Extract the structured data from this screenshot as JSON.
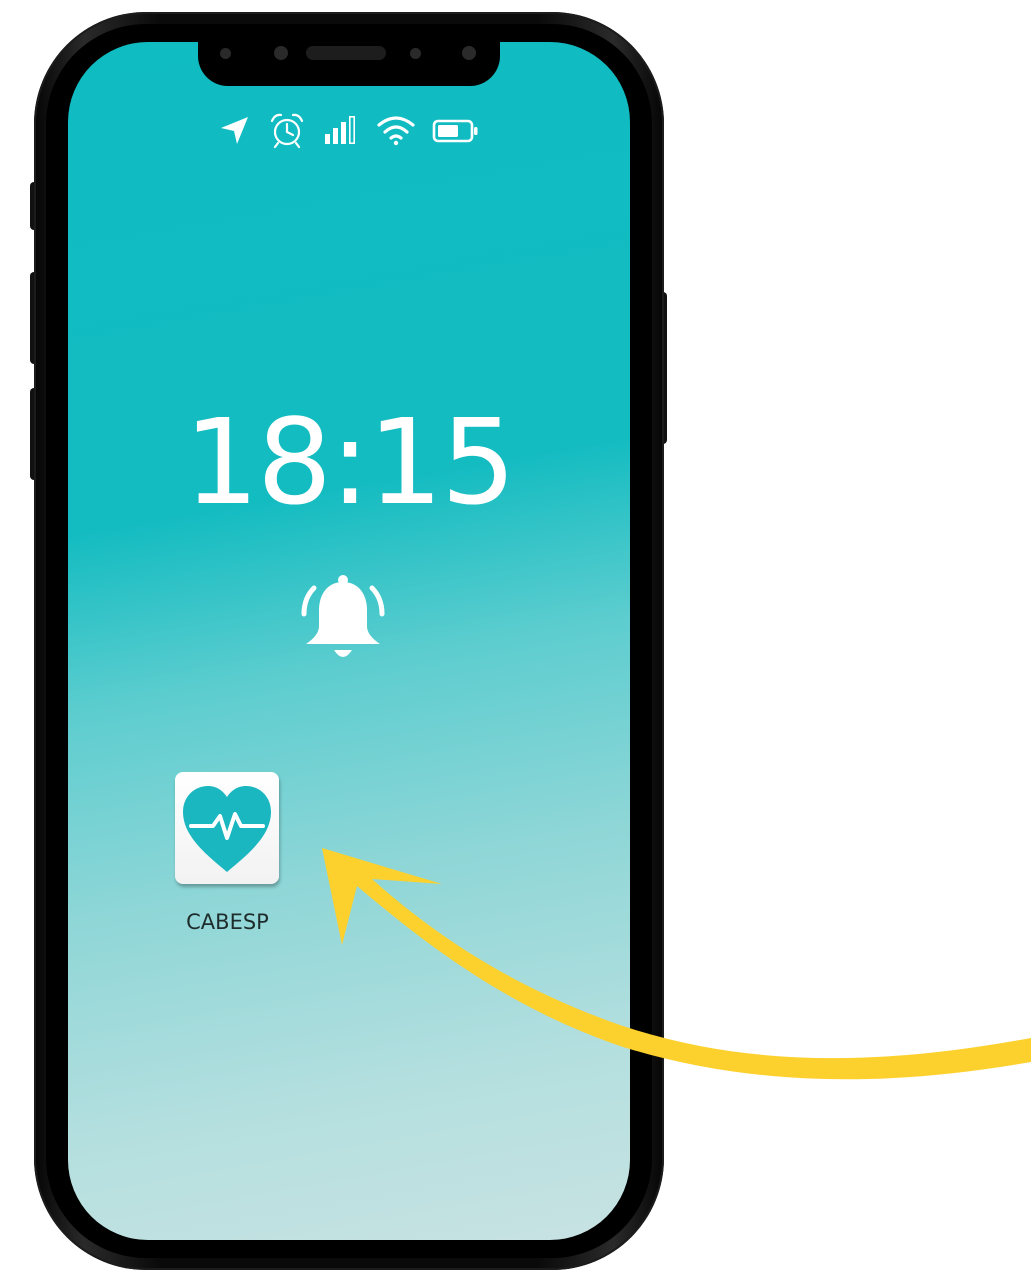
{
  "lock_screen": {
    "time": "18:15",
    "alarm_icon": "alarm-bell-icon"
  },
  "status_bar": {
    "icons": [
      "location-arrow-icon",
      "alarm-clock-icon",
      "cellular-signal-icon",
      "wifi-icon",
      "battery-icon"
    ]
  },
  "home_apps": [
    {
      "label": "CABESP",
      "icon": "heart-pulse-icon"
    }
  ],
  "colors": {
    "screen_top": "#0fbcc2",
    "screen_bottom": "#c8e2e2",
    "app_accent": "#1ab7c1",
    "arrow": "#fdd12d"
  }
}
